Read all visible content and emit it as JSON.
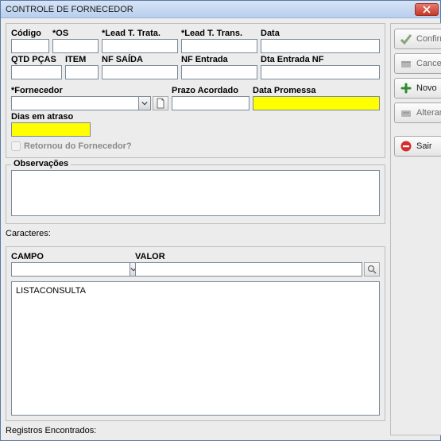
{
  "window": {
    "title": "CONTROLE DE FORNECEDOR"
  },
  "form": {
    "codigo": {
      "label": "Código",
      "value": ""
    },
    "os": {
      "label": "*OS",
      "value": ""
    },
    "lead_trata": {
      "label": "*Lead T. Trata.",
      "value": ""
    },
    "lead_trans": {
      "label": "*Lead T. Trans.",
      "value": ""
    },
    "data": {
      "label": "Data",
      "value": ""
    },
    "qtd_pcas": {
      "label": "QTD PÇAS",
      "value": ""
    },
    "item": {
      "label": "ITEM",
      "value": ""
    },
    "nf_saida": {
      "label": "NF SAÍDA",
      "value": ""
    },
    "nf_entrada": {
      "label": "NF Entrada",
      "value": ""
    },
    "dta_entrada_nf": {
      "label": "Dta Entrada NF",
      "value": ""
    },
    "fornecedor": {
      "label": "*Fornecedor",
      "value": ""
    },
    "prazo_acordado": {
      "label": "Prazo Acordado",
      "value": ""
    },
    "data_promessa": {
      "label": "Data Promessa",
      "value": ""
    },
    "dias_em_atraso": {
      "label": "Dias em atraso",
      "value": ""
    },
    "retornou": {
      "label": "Retornou do Fornecedor?"
    }
  },
  "buttons": {
    "confirmar": "Confirmar",
    "cancelar": "Cancelar",
    "novo": "Novo",
    "alterar": "Alterar",
    "sair": "Sair"
  },
  "obs": {
    "legend": "Observações",
    "value": "",
    "caracteres_label": "Caracteres:"
  },
  "filter": {
    "campo_label": "CAMPO",
    "campo_value": "",
    "valor_label": "VALOR",
    "valor_value": ""
  },
  "list": {
    "header": "LISTACONSULTA",
    "registros_label": "Registros Encontrados:"
  }
}
